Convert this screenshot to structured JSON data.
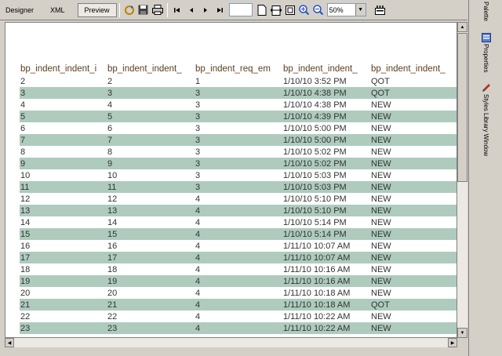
{
  "toolbar": {
    "designer_tab": "Designer",
    "xml_tab": "XML",
    "preview_tab": "Preview",
    "page_value": "",
    "zoom_value": "50%"
  },
  "side_panel": {
    "palette": "Palette",
    "properties": "Properties",
    "styles": "Styles Library Window"
  },
  "table": {
    "headers": [
      "bp_indent_indent_i",
      "bp_indent_indent_",
      "bp_indent_req_em",
      "bp_indent_indent_",
      "bp_indent_indent_"
    ],
    "rows": [
      [
        "2",
        "2",
        "1",
        "1/10/10 3:52 PM",
        "QOT"
      ],
      [
        "3",
        "3",
        "3",
        "1/10/10 4:38 PM",
        "QOT"
      ],
      [
        "4",
        "4",
        "3",
        "1/10/10 4:38 PM",
        "NEW"
      ],
      [
        "5",
        "5",
        "3",
        "1/10/10 4:39 PM",
        "NEW"
      ],
      [
        "6",
        "6",
        "3",
        "1/10/10 5:00 PM",
        "NEW"
      ],
      [
        "7",
        "7",
        "3",
        "1/10/10 5:00 PM",
        "NEW"
      ],
      [
        "8",
        "8",
        "3",
        "1/10/10 5:02 PM",
        "NEW"
      ],
      [
        "9",
        "9",
        "3",
        "1/10/10 5:02 PM",
        "NEW"
      ],
      [
        "10",
        "10",
        "3",
        "1/10/10 5:03 PM",
        "NEW"
      ],
      [
        "11",
        "11",
        "3",
        "1/10/10 5:03 PM",
        "NEW"
      ],
      [
        "12",
        "12",
        "4",
        "1/10/10 5:10 PM",
        "NEW"
      ],
      [
        "13",
        "13",
        "4",
        "1/10/10 5:10 PM",
        "NEW"
      ],
      [
        "14",
        "14",
        "4",
        "1/10/10 5:14 PM",
        "NEW"
      ],
      [
        "15",
        "15",
        "4",
        "1/10/10 5:14 PM",
        "NEW"
      ],
      [
        "16",
        "16",
        "4",
        "1/11/10 10:07 AM",
        "NEW"
      ],
      [
        "17",
        "17",
        "4",
        "1/11/10 10:07 AM",
        "NEW"
      ],
      [
        "18",
        "18",
        "4",
        "1/11/10 10:16 AM",
        "NEW"
      ],
      [
        "19",
        "19",
        "4",
        "1/11/10 10:16 AM",
        "NEW"
      ],
      [
        "20",
        "20",
        "4",
        "1/11/10 10:18 AM",
        "NEW"
      ],
      [
        "21",
        "21",
        "4",
        "1/11/10 10:18 AM",
        "QOT"
      ],
      [
        "22",
        "22",
        "4",
        "1/11/10 10:22 AM",
        "NEW"
      ],
      [
        "23",
        "23",
        "4",
        "1/11/10 10:22 AM",
        "NEW"
      ]
    ],
    "alt_color": "#aecbbe"
  }
}
